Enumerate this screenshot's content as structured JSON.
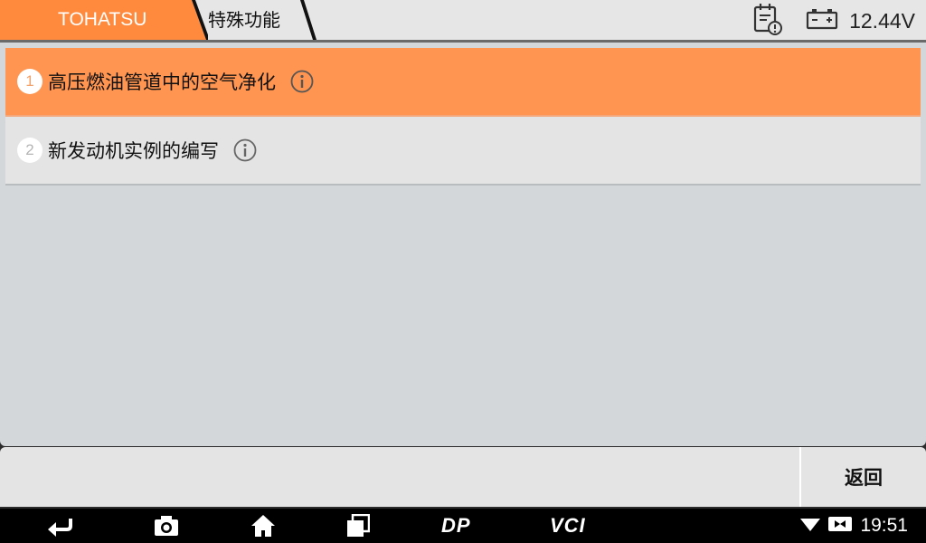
{
  "header": {
    "brand": "TOHATSU",
    "section": "特殊功能",
    "voltage": "12.44V",
    "colors": {
      "brand_bg": "#ff8a3d",
      "active_row": "#ff9550"
    }
  },
  "menu": {
    "items": [
      {
        "number": "1",
        "label": "高压燃油管道中的空气净化",
        "active": true
      },
      {
        "number": "2",
        "label": "新发动机实例的编写",
        "active": false
      }
    ]
  },
  "actions": {
    "back_label": "返回"
  },
  "navbar": {
    "dp_label": "DP",
    "vci_label": "VCI",
    "time": "19:51"
  },
  "icons": [
    "calendar-alert-icon",
    "battery-icon",
    "info-icon",
    "back-arrow-icon",
    "camera-icon",
    "home-icon",
    "recents-icon",
    "wifi-icon",
    "sim-icon"
  ]
}
